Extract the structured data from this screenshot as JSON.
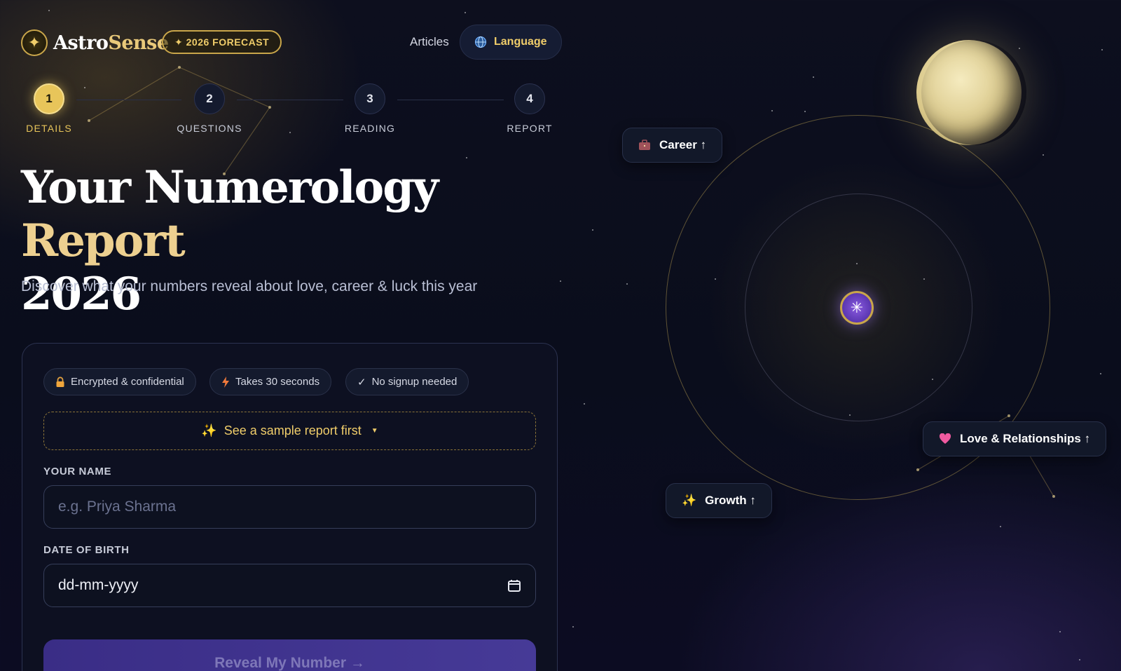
{
  "header": {
    "brand_a": "Astro",
    "brand_b": "Sense",
    "forecast_badge": "✦ 2026 FORECAST",
    "nav_articles": "Articles",
    "language_label": "Language"
  },
  "steps": [
    {
      "num": "1",
      "label": "DETAILS",
      "active": true
    },
    {
      "num": "2",
      "label": "QUESTIONS",
      "active": false
    },
    {
      "num": "3",
      "label": "READING",
      "active": false
    },
    {
      "num": "4",
      "label": "REPORT",
      "active": false
    }
  ],
  "hero": {
    "title_a": "Your Numerology ",
    "title_b": "Report",
    "title_c": "2026",
    "subtitle": "Discover what your numbers reveal about love, career & luck this year"
  },
  "form": {
    "chips": [
      {
        "icon": "lock-icon",
        "label": "Encrypted & confidential"
      },
      {
        "icon": "lightning-icon",
        "label": "Takes 30 seconds"
      },
      {
        "icon": "check-icon",
        "label": "No signup needed"
      }
    ],
    "sample_toggle": "See a sample report first",
    "name_label": "YOUR NAME",
    "name_placeholder": "e.g. Priya Sharma",
    "dob_label": "DATE OF BIRTH",
    "dob_value": "dd-mm-yyyy",
    "submit_label": "Reveal My Number →"
  },
  "visual": {
    "tags": [
      {
        "icon": "briefcase-icon",
        "label": "Career ↑"
      },
      {
        "icon": "heart-icon",
        "label": "Love & Relationships ↑"
      },
      {
        "icon": "sparkles-icon",
        "label": "Growth ↑"
      }
    ]
  },
  "colors": {
    "gold": "#e8c55a",
    "background": "#0b0e1d",
    "button": "#3a2d86"
  }
}
